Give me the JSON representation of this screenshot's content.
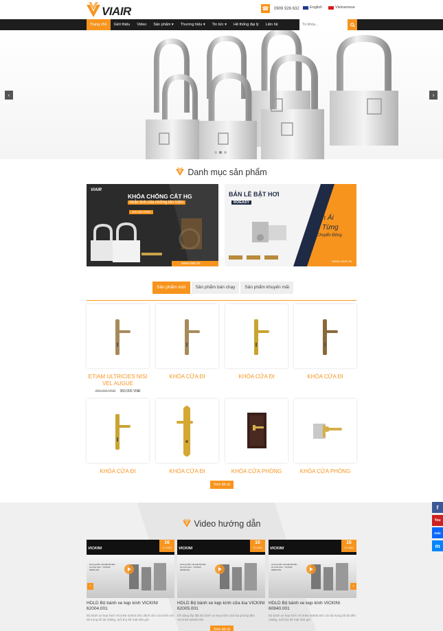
{
  "header": {
    "logo_text": "VIAIR",
    "phone": "0909 926 632",
    "lang_en": "English",
    "lang_vi": "Vietnamese"
  },
  "nav": {
    "items": [
      {
        "label": "Trang chủ",
        "active": true
      },
      {
        "label": "Giới thiệu"
      },
      {
        "label": "Video"
      },
      {
        "label": "Sản phẩm ▾"
      },
      {
        "label": "Thương hiệu ▾"
      },
      {
        "label": "Tin tức ▾"
      },
      {
        "label": "Hệ thống đại lý"
      },
      {
        "label": "Liên hệ"
      }
    ],
    "search_placeholder": "Từ khóa..."
  },
  "categories": {
    "title": "Danh mục sản phẩm",
    "banner1": {
      "brand": "VIAIR",
      "headline": "KHÓA CHỐNG CẮT HG",
      "subhead": "khắc tinh của những tên trộm",
      "button": "XEM SẢN PHẨM",
      "url": "www.viair.vn"
    },
    "banner2": {
      "headline": "BẢN LỀ BẬT HƠI",
      "brand": "ROEASY",
      "slogan1": "Êm Ái",
      "slogan2": "Từng",
      "slogan3": "Chuyển Động",
      "url": "WWW.VIAIR.VN"
    }
  },
  "tabs": [
    "Sản phẩm mới",
    "Sản phẩm bán chạy",
    "Sản phẩm khuyến mãi"
  ],
  "products": [
    {
      "name": "ETIAM ULTRICIES NISI VEL AUGUE",
      "price_old": "300,000 VNĐ",
      "price_new": "350,000 VNĐ"
    },
    {
      "name": "KHÓA CỬA ĐI"
    },
    {
      "name": "KHÓA CỬA ĐI"
    },
    {
      "name": "KHÓA CỬA ĐI"
    },
    {
      "name": "KHÓA CỬA ĐI"
    },
    {
      "name": "KHÓA CỬA ĐI"
    },
    {
      "name": "KHÓA CỬA PHÒNG"
    },
    {
      "name": "KHÓA CỬA PHÒNG"
    }
  ],
  "view_all": "Xem tất cả",
  "videos": {
    "title": "Video hướng dẫn",
    "items": [
      {
        "brand": "VICKINI",
        "day": "16",
        "month": "07-2020",
        "caption": "Hướng Dẫn Lắp Đặt Bộ Bản Lề Cửa Kính - VICKINI 62004.001",
        "title": "HDLD Bộ bánh xe kẹp kính VICKINI 62004.001",
        "desc": "Bộ bánh xe kẹp kính VICKINI 62004.001 dành cho cửa kính với tải trọng tối đa 200kg, tuổi thọ bề mặt 360 giờ."
      },
      {
        "brand": "VICKINI",
        "day": "16",
        "month": "07-2020",
        "caption": "Hướng Dẫn Lắp Đặt Bộ Bản Lề Cửa Kính - VICKINI 62005.001",
        "title": "HDLD Bộ bánh xe kẹp kính cửa lùa VICKINI 62005.001",
        "desc": "Dễ dàng lắp đặt Bộ bánh xe kẹp kính cửa lùa phòng tắm VICKINI 62005.001"
      },
      {
        "brand": "VICKINI",
        "day": "16",
        "month": "07-2020",
        "caption": "Hướng Dẫn Lắp Đặt Bộ Bản Lề Cửa Kính - VICKINI 60840.001",
        "title": "HDLD Bộ bánh xe kẹp kính VICKINI 60840.001",
        "desc": "Bộ bánh xe kẹp kính VICKINI 60840.001 với tải trọng tối đa đến 100kg, tuổi thọ bề mặt 360 giờ."
      }
    ]
  },
  "social": {
    "fb": "f",
    "yt": "You",
    "zalo": "Zalo",
    "msg": "m"
  },
  "colors": {
    "accent": "#f7941d",
    "nav_bg": "#1d1d1d"
  }
}
